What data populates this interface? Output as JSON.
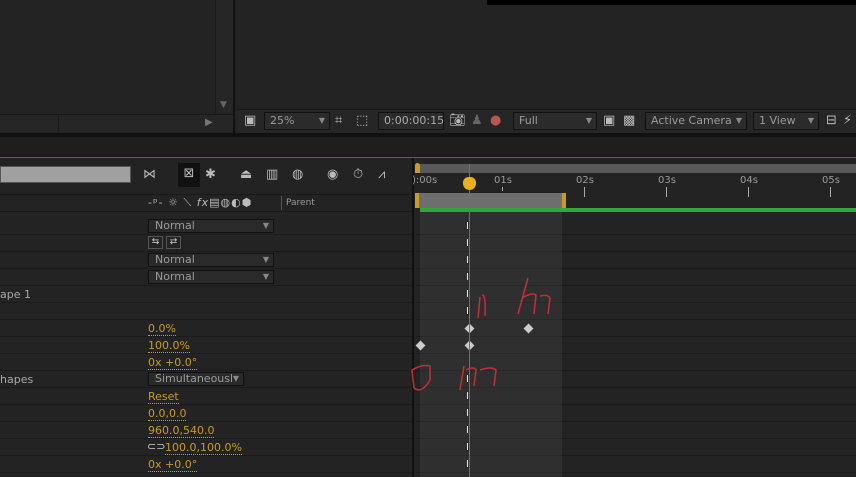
{
  "viewer": {
    "zoom": "25%",
    "timecode": "0:00:00:15",
    "resolution": "Full",
    "camera": "Active Camera",
    "views": "1 View"
  },
  "timeline": {
    "columns_header": {
      "parent": "Parent"
    },
    "ruler": [
      "):00s",
      "01s",
      "02s",
      "03s",
      "04s",
      "05s"
    ],
    "current_time_seconds": 0.6,
    "work_area_end_seconds": 1.75
  },
  "layers": {
    "blend_mode_1": "Normal",
    "blend_mode_2": "Normal",
    "blend_mode_3": "Normal",
    "shape_name": "ape 1",
    "prop_1": "0.0%",
    "prop_2": "100.0%",
    "prop_3": "0x +0.0°",
    "composite_label": "hapes",
    "composite_value": "Simultaneousl",
    "reset": "Reset",
    "anchor": "0.0,0.0",
    "position": "960.0,540.0",
    "scale": "100.0,100.0%",
    "rotation": "0x +0.0°"
  },
  "colors": {
    "accent": "#c89a2c",
    "work_area_bar": "#2fa83a",
    "playhead": "#d04545",
    "cti": "#e8b21e"
  }
}
